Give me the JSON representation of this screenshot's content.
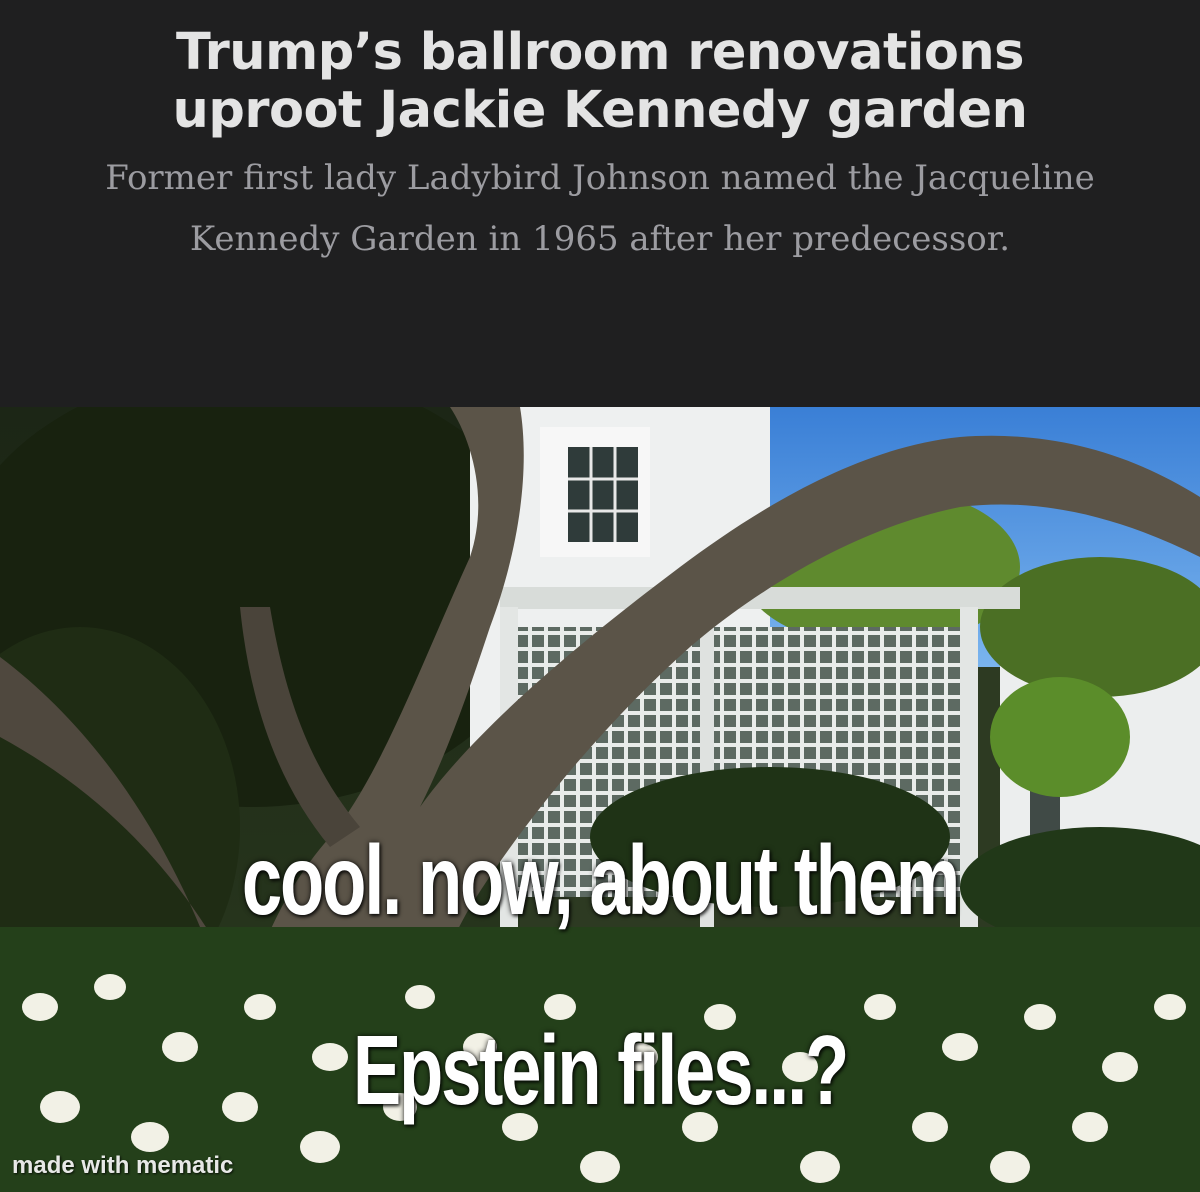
{
  "article": {
    "headline_line1": "Trump’s ballroom renovations",
    "headline_line2": "uproot Jackie Kennedy garden",
    "subhead": "Former first lady Ladybird Johnson named the Jacqueline Kennedy Garden in 1965 after her predecessor."
  },
  "meme": {
    "caption_line1": "cool. now, about them",
    "caption_line2": "Epstein files...?",
    "watermark": "made with mematic"
  },
  "colors": {
    "header_bg": "#1f1f20",
    "headline": "#e4e4e4",
    "subhead": "#9c9ca1",
    "caption": "#ffffff"
  }
}
